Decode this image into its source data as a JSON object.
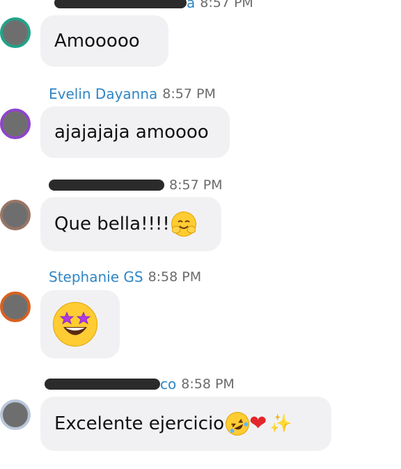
{
  "messages": [
    {
      "sender_visible": "a",
      "time": "8:57 PM",
      "text": "Amooooo",
      "avatar_ring": "#20a38a",
      "sender_redacted": true
    },
    {
      "sender_visible": "Evelin Dayanna",
      "time": "8:57 PM",
      "text": "ajajajaja amoooo",
      "avatar_ring": "#8e44c9",
      "sender_redacted": false
    },
    {
      "sender_visible": "",
      "time": "8:57 PM",
      "text": "Que bella!!!! ",
      "emoji": [
        "smiling-face-with-open-hands-emoji"
      ],
      "avatar_ring": "#9a7564",
      "sender_redacted": true
    },
    {
      "sender_visible": "Stephanie GS",
      "time": "8:58 PM",
      "text": "",
      "emoji": [
        "star-struck-emoji"
      ],
      "avatar_ring": "#d86020",
      "sender_redacted": false
    },
    {
      "sender_visible": "co",
      "time": "8:58 PM",
      "text": "Excelente ejercicio ",
      "emoji": [
        "rolling-on-the-floor-laughing-emoji",
        "red-heart-emoji",
        "sparkles-emoji"
      ],
      "avatar_ring": "#b9c7d9",
      "sender_redacted": true
    }
  ],
  "colors": {
    "sender_name": "#2f86c5",
    "bubble_bg": "#f1f1f4",
    "time": "#6b6b6b",
    "message_text": "#111111"
  }
}
